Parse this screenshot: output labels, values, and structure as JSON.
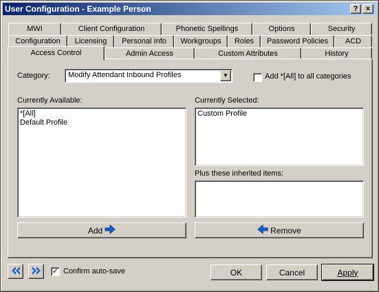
{
  "window": {
    "title": "User Configuration - Example Person",
    "help_label": "?",
    "close_label": "×"
  },
  "tabs": {
    "row1": [
      "MWI",
      "Client Configuration",
      "Phonetic Spellings",
      "Options",
      "Security"
    ],
    "row2": [
      "Configuration",
      "Licensing",
      "Personal Info",
      "Workgroups",
      "Roles",
      "Password Policies",
      "ACD"
    ],
    "row3": [
      "Access Control",
      "Admin Access",
      "Custom Attributes",
      "History"
    ],
    "active": "Access Control"
  },
  "access_control": {
    "category_label": "Category:",
    "category_value": "Modify Attendant Inbound Profiles",
    "add_all_label": "Add *[All] to all categories",
    "add_all_checked": false,
    "available_label": "Currently Available:",
    "available_items": [
      "*[All]",
      "Default Profile"
    ],
    "selected_label": "Currently Selected:",
    "selected_items": [
      "Custom Profile"
    ],
    "inherited_label": "Plus these inherited items:",
    "inherited_items": [],
    "add_button": "Add",
    "remove_button": "Remove"
  },
  "footer": {
    "confirm_autosave_label": "Confirm auto-save",
    "confirm_autosave_checked": true,
    "ok_button": "OK",
    "cancel_button": "Cancel",
    "apply_button": "Apply"
  },
  "colors": {
    "title_gradient_start": "#0a246a",
    "title_gradient_end": "#a6caf0",
    "arrow_blue": "#1c5fc8",
    "face": "#d4d0c8"
  }
}
